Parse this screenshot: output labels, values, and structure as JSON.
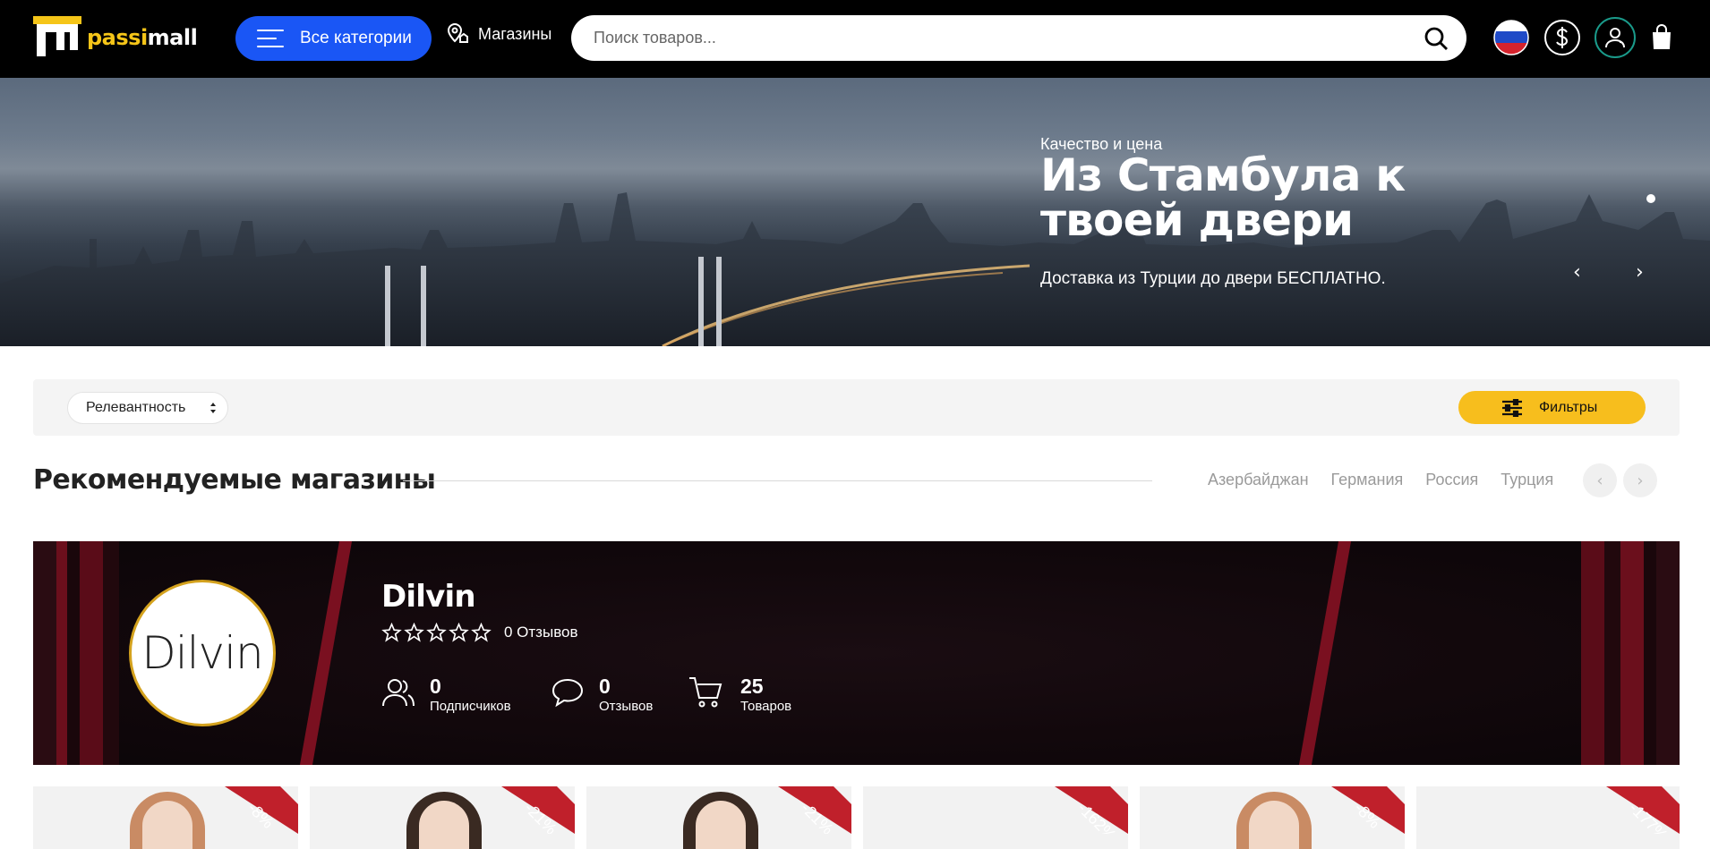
{
  "header": {
    "logo": {
      "part1": "passi",
      "part2": "mall"
    },
    "categories_label": "Все категории",
    "stores_label": "Магазины",
    "search_placeholder": "Поиск товаров..."
  },
  "hero": {
    "subtitle": "Качество и цена",
    "title": "Из Стамбула к твоей двери",
    "description": "Доставка из Турции до двери БЕСПЛАТНО.",
    "prev": "‹",
    "next": "›"
  },
  "filters": {
    "sort_label": "Релевантность",
    "filters_label": "Фильтры"
  },
  "recommended": {
    "title": "Рекомендуемые магазины",
    "countries": [
      "Азербайджан",
      "Германия",
      "Россия",
      "Турция"
    ],
    "prev": "‹",
    "next": "›"
  },
  "store": {
    "logo_text": "Dilvin",
    "name": "Dilvin",
    "reviews_text": "0 Отзывов",
    "rating": 0,
    "stats": [
      {
        "value": "0",
        "label": "Подписчиков",
        "icon": "users-icon"
      },
      {
        "value": "0",
        "label": "Отзывов",
        "icon": "chat-bubble-icon"
      },
      {
        "value": "25",
        "label": "Товаров",
        "icon": "cart-icon"
      }
    ]
  },
  "products": [
    {
      "discount": "-8%"
    },
    {
      "discount": "-21%"
    },
    {
      "discount": "-21%"
    },
    {
      "discount": "-162%"
    },
    {
      "discount": "-8%"
    },
    {
      "discount": "-177%"
    }
  ],
  "colors": {
    "accent_blue": "#1a56f5",
    "accent_yellow": "#f7be1d",
    "badge_red": "#c0202b",
    "logo_yellow": "#f5c518"
  }
}
